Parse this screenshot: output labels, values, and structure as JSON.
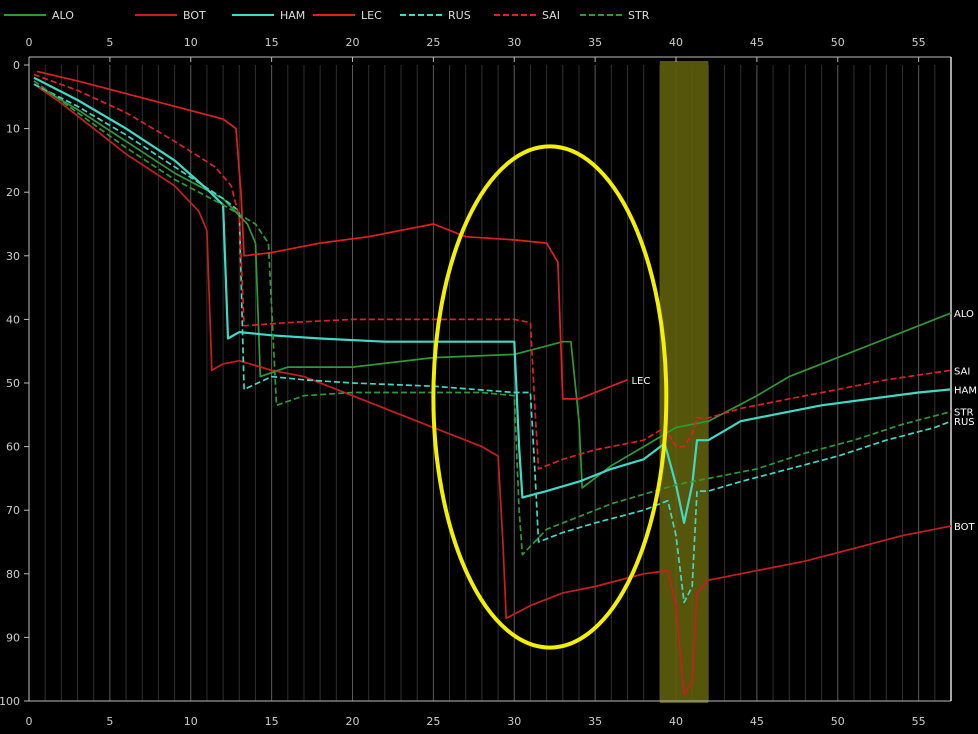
{
  "chart_data": {
    "type": "line",
    "title": "",
    "xlabel": "",
    "ylabel": "",
    "xlim": [
      0,
      57
    ],
    "ylim": [
      0,
      100
    ],
    "y_inverted": true,
    "grid": "vertical lines every 1 (major every 5)",
    "legend_position": "top",
    "x_ticks": [
      "0",
      "5",
      "10",
      "15",
      "20",
      "25",
      "30",
      "35",
      "40",
      "45",
      "50",
      "55"
    ],
    "y_ticks": [
      "0",
      "10",
      "20",
      "30",
      "40",
      "50",
      "60",
      "70",
      "80",
      "90",
      "100"
    ],
    "highlight_band": {
      "x_start": 39,
      "x_end": 42,
      "color": "#5e5e0c"
    },
    "annotation": {
      "shape": "ellipse",
      "color": "#f4f000",
      "center": [
        32.2,
        52.2
      ],
      "x_radius": 7.2,
      "y_radius": 39.4
    },
    "series": [
      {
        "name": "ALO",
        "color": "#2f9a35",
        "dash": false,
        "end_label": "ALO",
        "points": [
          [
            0.3,
            3
          ],
          [
            3,
            7
          ],
          [
            6,
            12
          ],
          [
            9,
            17
          ],
          [
            12,
            21
          ],
          [
            13.5,
            25
          ],
          [
            14,
            28
          ],
          [
            14.3,
            49
          ],
          [
            16,
            47.5
          ],
          [
            20,
            47.5
          ],
          [
            25,
            46
          ],
          [
            30,
            45.5
          ],
          [
            33,
            43.5
          ],
          [
            33.5,
            43.5
          ],
          [
            34,
            56
          ],
          [
            34.2,
            66.5
          ],
          [
            36,
            63
          ],
          [
            38,
            60
          ],
          [
            40,
            57
          ],
          [
            42,
            56
          ],
          [
            45,
            52
          ],
          [
            47,
            49
          ],
          [
            50,
            46
          ],
          [
            53,
            43
          ],
          [
            57,
            39
          ]
        ]
      },
      {
        "name": "BOT",
        "color": "#c81e1e",
        "dash": false,
        "end_label": "BOT",
        "points": [
          [
            0.3,
            3
          ],
          [
            2,
            6
          ],
          [
            4,
            10
          ],
          [
            6,
            14
          ],
          [
            9,
            19
          ],
          [
            10.5,
            23
          ],
          [
            11,
            26
          ],
          [
            11.3,
            48
          ],
          [
            12,
            47
          ],
          [
            13,
            46.5
          ],
          [
            15,
            48
          ],
          [
            17,
            49
          ],
          [
            20,
            52
          ],
          [
            23,
            55
          ],
          [
            26,
            58
          ],
          [
            28,
            60
          ],
          [
            29,
            61.5
          ],
          [
            29.3,
            75
          ],
          [
            29.5,
            87
          ],
          [
            31,
            85
          ],
          [
            33,
            83
          ],
          [
            35,
            82
          ],
          [
            38,
            80
          ],
          [
            39.5,
            79.5
          ],
          [
            40,
            85
          ],
          [
            40.5,
            99
          ],
          [
            41,
            97
          ],
          [
            41.3,
            83
          ],
          [
            42,
            81
          ],
          [
            45,
            79.5
          ],
          [
            48,
            78
          ],
          [
            51,
            76
          ],
          [
            54,
            74
          ],
          [
            57,
            72.5
          ]
        ]
      },
      {
        "name": "HAM",
        "color": "#3fd9c5",
        "dash": false,
        "end_label": "HAM",
        "points": [
          [
            0.3,
            2
          ],
          [
            3,
            5.5
          ],
          [
            6,
            10
          ],
          [
            9,
            15
          ],
          [
            11,
            19.5
          ],
          [
            12,
            22
          ],
          [
            12.3,
            43
          ],
          [
            13,
            42
          ],
          [
            15,
            42.5
          ],
          [
            18,
            43
          ],
          [
            22,
            43.5
          ],
          [
            26,
            43.5
          ],
          [
            30,
            43.5
          ],
          [
            30.3,
            60
          ],
          [
            30.5,
            68
          ],
          [
            32,
            67
          ],
          [
            34,
            65.5
          ],
          [
            36,
            63.5
          ],
          [
            38,
            62
          ],
          [
            39.3,
            59.5
          ],
          [
            40,
            66
          ],
          [
            40.5,
            72
          ],
          [
            41,
            66
          ],
          [
            41.3,
            59
          ],
          [
            42,
            59
          ],
          [
            44,
            56
          ],
          [
            46,
            55
          ],
          [
            49,
            53.5
          ],
          [
            52,
            52.5
          ],
          [
            55,
            51.5
          ],
          [
            57,
            51
          ]
        ]
      },
      {
        "name": "LEC",
        "color": "#e02020",
        "dash": false,
        "end_label": "LEC",
        "end_x": 37,
        "points": [
          [
            0.5,
            1
          ],
          [
            3,
            2.5
          ],
          [
            6,
            4.5
          ],
          [
            9,
            6.5
          ],
          [
            12,
            8.5
          ],
          [
            12.8,
            10
          ],
          [
            13.1,
            20
          ],
          [
            13.3,
            30
          ],
          [
            15,
            29.5
          ],
          [
            18,
            28
          ],
          [
            21,
            27
          ],
          [
            24,
            25.5
          ],
          [
            25,
            25
          ],
          [
            27,
            27
          ],
          [
            30,
            27.5
          ],
          [
            32,
            28
          ],
          [
            32.7,
            31
          ],
          [
            33,
            52.5
          ],
          [
            34,
            52.5
          ],
          [
            35,
            51.5
          ],
          [
            37,
            49.5
          ]
        ]
      },
      {
        "name": "RUS",
        "color": "#3fd9c5",
        "dash": true,
        "end_label": "RUS",
        "points": [
          [
            0.3,
            3
          ],
          [
            3,
            6.5
          ],
          [
            6,
            11
          ],
          [
            9,
            16
          ],
          [
            12,
            21
          ],
          [
            13,
            23
          ],
          [
            13.3,
            51
          ],
          [
            15,
            49
          ],
          [
            17,
            49.5
          ],
          [
            20,
            50
          ],
          [
            25,
            50.5
          ],
          [
            30,
            51.5
          ],
          [
            31,
            51.5
          ],
          [
            31.3,
            65
          ],
          [
            31.5,
            75
          ],
          [
            33,
            73.5
          ],
          [
            35,
            72
          ],
          [
            38,
            70
          ],
          [
            39.5,
            68.5
          ],
          [
            40,
            74
          ],
          [
            40.5,
            84.5
          ],
          [
            41,
            82
          ],
          [
            41.3,
            67
          ],
          [
            42,
            67
          ],
          [
            44,
            65.5
          ],
          [
            47,
            63.5
          ],
          [
            50,
            61.5
          ],
          [
            53,
            59
          ],
          [
            56,
            57
          ],
          [
            57,
            56
          ]
        ]
      },
      {
        "name": "SAI",
        "color": "#e02020",
        "dash": true,
        "end_label": "SAI",
        "points": [
          [
            0.3,
            1.5
          ],
          [
            3,
            4
          ],
          [
            6,
            7.5
          ],
          [
            9,
            12
          ],
          [
            11.5,
            16
          ],
          [
            12.5,
            19
          ],
          [
            13,
            24
          ],
          [
            13.3,
            41
          ],
          [
            16,
            40.5
          ],
          [
            20,
            40
          ],
          [
            25,
            40
          ],
          [
            30,
            40
          ],
          [
            31,
            40.5
          ],
          [
            31.3,
            55
          ],
          [
            31.5,
            63.5
          ],
          [
            33,
            62
          ],
          [
            35,
            60.5
          ],
          [
            38,
            59
          ],
          [
            39.3,
            57
          ],
          [
            40,
            60
          ],
          [
            40.5,
            60
          ],
          [
            41,
            58
          ],
          [
            41.3,
            55.5
          ],
          [
            42,
            55.5
          ],
          [
            44,
            54
          ],
          [
            47,
            52.5
          ],
          [
            50,
            51
          ],
          [
            53,
            49.5
          ],
          [
            57,
            48
          ]
        ]
      },
      {
        "name": "STR",
        "color": "#2f9a35",
        "dash": true,
        "end_label": "STR",
        "points": [
          [
            0.3,
            2.5
          ],
          [
            3,
            7.5
          ],
          [
            6,
            13
          ],
          [
            9,
            18
          ],
          [
            12,
            22
          ],
          [
            14,
            25
          ],
          [
            14.8,
            28
          ],
          [
            15.3,
            53.5
          ],
          [
            17,
            52
          ],
          [
            20,
            51.5
          ],
          [
            25,
            51.5
          ],
          [
            28,
            51.5
          ],
          [
            30,
            52
          ],
          [
            30.3,
            70
          ],
          [
            30.5,
            77
          ],
          [
            32,
            73
          ],
          [
            34,
            71
          ],
          [
            36,
            69
          ],
          [
            38,
            67.5
          ],
          [
            40,
            66
          ],
          [
            42,
            65
          ],
          [
            45,
            63.5
          ],
          [
            48,
            61
          ],
          [
            51,
            59
          ],
          [
            54,
            56.5
          ],
          [
            57,
            54.5
          ]
        ]
      }
    ]
  }
}
